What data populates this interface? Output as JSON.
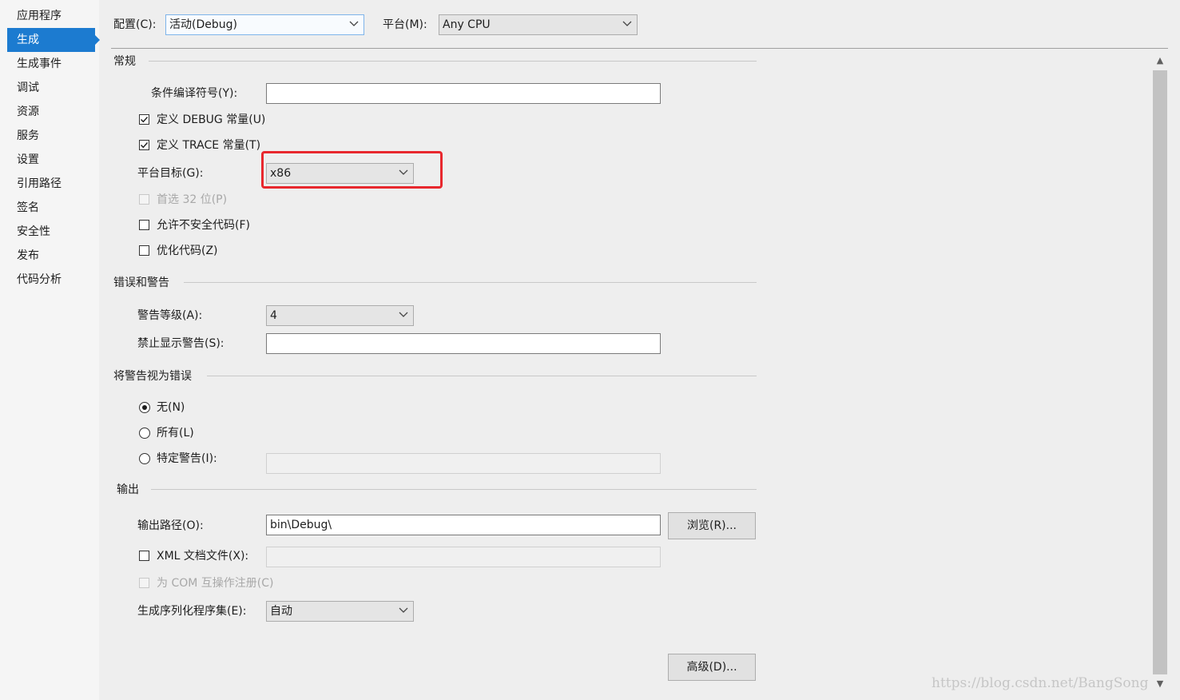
{
  "sidebar": {
    "items": [
      {
        "label": "应用程序"
      },
      {
        "label": "生成",
        "active": true
      },
      {
        "label": "生成事件"
      },
      {
        "label": "调试"
      },
      {
        "label": "资源"
      },
      {
        "label": "服务"
      },
      {
        "label": "设置"
      },
      {
        "label": "引用路径"
      },
      {
        "label": "签名"
      },
      {
        "label": "安全性"
      },
      {
        "label": "发布"
      },
      {
        "label": "代码分析"
      }
    ]
  },
  "header": {
    "config_label": "配置(C):",
    "config_value": "活动(Debug)",
    "platform_label": "平台(M):",
    "platform_value": "Any CPU"
  },
  "general": {
    "title": "常规",
    "symbols_label": "条件编译符号(Y):",
    "symbols_value": "",
    "debug_label": "定义 DEBUG 常量(U)",
    "debug_checked": true,
    "trace_label": "定义 TRACE 常量(T)",
    "trace_checked": true,
    "platform_target_label": "平台目标(G):",
    "platform_target_value": "x86",
    "prefer32_label": "首选 32 位(P)",
    "prefer32_enabled": false,
    "unsafe_label": "允许不安全代码(F)",
    "unsafe_checked": false,
    "optimize_label": "优化代码(Z)",
    "optimize_checked": false
  },
  "errors": {
    "title": "错误和警告",
    "warning_level_label": "警告等级(A):",
    "warning_level_value": "4",
    "suppress_label": "禁止显示警告(S):",
    "suppress_value": ""
  },
  "treat_warnings": {
    "title": "将警告视为错误",
    "none_label": "无(N)",
    "all_label": "所有(L)",
    "specific_label": "特定警告(I):",
    "selected": "none",
    "specific_value": ""
  },
  "output": {
    "title": "输出",
    "path_label": "输出路径(O):",
    "path_value": "bin\\Debug\\",
    "browse_label": "浏览(R)...",
    "xml_label": "XML 文档文件(X):",
    "xml_checked": false,
    "xml_value": "",
    "com_label": "为 COM 互操作注册(C)",
    "com_enabled": false,
    "serialization_label": "生成序列化程序集(E):",
    "serialization_value": "自动",
    "advanced_label": "高级(D)..."
  },
  "watermark": "https://blog.csdn.net/BangSong",
  "colors": {
    "accent": "#1c7bd0",
    "highlight_border": "#e8282e"
  }
}
